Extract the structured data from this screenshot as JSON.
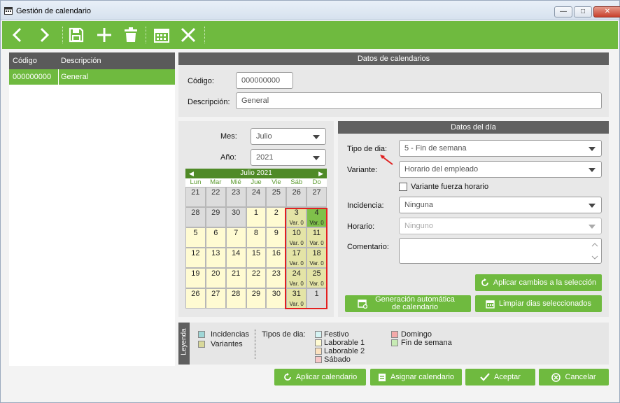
{
  "window": {
    "title": "Gestión de calendario"
  },
  "list": {
    "headers": [
      "Código",
      "Descripción"
    ],
    "rows": [
      {
        "code": "000000000",
        "desc": "General"
      }
    ]
  },
  "datos_calendario": {
    "title": "Datos de calendarios",
    "codigo_label": "Código:",
    "codigo_value": "000000000",
    "descripcion_label": "Descripción:",
    "descripcion_value": "General"
  },
  "month_year": {
    "mes_label": "Mes:",
    "mes_value": "Julio",
    "anio_label": "Año:",
    "anio_value": "2021"
  },
  "calendar": {
    "title": "Julio 2021",
    "weekdays": [
      "Lun",
      "Mar",
      "Mié",
      "Jue",
      "Vie",
      "Sáb",
      "Do"
    ],
    "cells": [
      {
        "d": "21",
        "t": "gray"
      },
      {
        "d": "22",
        "t": "gray"
      },
      {
        "d": "23",
        "t": "gray"
      },
      {
        "d": "24",
        "t": "gray"
      },
      {
        "d": "25",
        "t": "gray"
      },
      {
        "d": "26",
        "t": "gray"
      },
      {
        "d": "27",
        "t": "gray"
      },
      {
        "d": "28",
        "t": "gray"
      },
      {
        "d": "29",
        "t": "gray"
      },
      {
        "d": "30",
        "t": "gray"
      },
      {
        "d": "1",
        "t": "norm"
      },
      {
        "d": "2",
        "t": "norm"
      },
      {
        "d": "3",
        "t": "var",
        "v": "Var. 0"
      },
      {
        "d": "4",
        "t": "fin",
        "v": "Var. 0"
      },
      {
        "d": "5",
        "t": "norm"
      },
      {
        "d": "6",
        "t": "norm"
      },
      {
        "d": "7",
        "t": "norm"
      },
      {
        "d": "8",
        "t": "norm"
      },
      {
        "d": "9",
        "t": "norm"
      },
      {
        "d": "10",
        "t": "var",
        "v": "Var. 0"
      },
      {
        "d": "11",
        "t": "var",
        "v": "Var. 0"
      },
      {
        "d": "12",
        "t": "norm"
      },
      {
        "d": "13",
        "t": "norm"
      },
      {
        "d": "14",
        "t": "norm"
      },
      {
        "d": "15",
        "t": "norm"
      },
      {
        "d": "16",
        "t": "norm"
      },
      {
        "d": "17",
        "t": "var",
        "v": "Var. 0"
      },
      {
        "d": "18",
        "t": "var",
        "v": "Var. 0"
      },
      {
        "d": "19",
        "t": "norm"
      },
      {
        "d": "20",
        "t": "norm"
      },
      {
        "d": "21",
        "t": "norm"
      },
      {
        "d": "22",
        "t": "norm"
      },
      {
        "d": "23",
        "t": "norm"
      },
      {
        "d": "24",
        "t": "var",
        "v": "Var. 0"
      },
      {
        "d": "25",
        "t": "var",
        "v": "Var. 0"
      },
      {
        "d": "26",
        "t": "norm"
      },
      {
        "d": "27",
        "t": "norm"
      },
      {
        "d": "28",
        "t": "norm"
      },
      {
        "d": "29",
        "t": "norm"
      },
      {
        "d": "30",
        "t": "norm"
      },
      {
        "d": "31",
        "t": "var",
        "v": "Var. 0"
      },
      {
        "d": "1",
        "t": "gray"
      }
    ]
  },
  "datos_dia": {
    "title": "Datos del día",
    "tipo_label": "Tipo de dia:",
    "tipo_value": "5 - Fin de semana",
    "variante_label": "Variante:",
    "variante_value": "Horario del empleado",
    "fuerza_label": "Variante fuerza horario",
    "incidencia_label": "Incidencia:",
    "incidencia_value": "Ninguna",
    "horario_label": "Horario:",
    "horario_value": "Ninguno",
    "comentario_label": "Comentario:"
  },
  "buttons": {
    "aplicar_cambios": "Aplicar cambios a la selección",
    "generacion": "Generación automática de calendario",
    "limpiar": "Limpiar dias seleccionados",
    "aplicar_calendario": "Aplicar calendario",
    "asignar": "Asignar calendario",
    "aceptar": "Aceptar",
    "cancelar": "Cancelar"
  },
  "legend": {
    "tab": "Leyenda",
    "incidencias": "Incidencias",
    "variantes": "Variantes",
    "tipos_label": "Tipos de dia:",
    "festivo": "Festivo",
    "laborable1": "Laborable 1",
    "laborable2": "Laborable 2",
    "sabado": "Sábado",
    "domingo": "Domingo",
    "fin_semana": "Fin de semana"
  },
  "colors": {
    "green": "#6fba3f",
    "incidencias": "#9fd6d6",
    "variantes": "#d8d89a",
    "festivo": "#d5f3f3",
    "laborable1": "#fffbd2",
    "laborable2": "#fbe1bf",
    "sabado": "#f7c8c8",
    "domingo": "#f4a9a9",
    "fin_semana": "#c7ebb4"
  }
}
